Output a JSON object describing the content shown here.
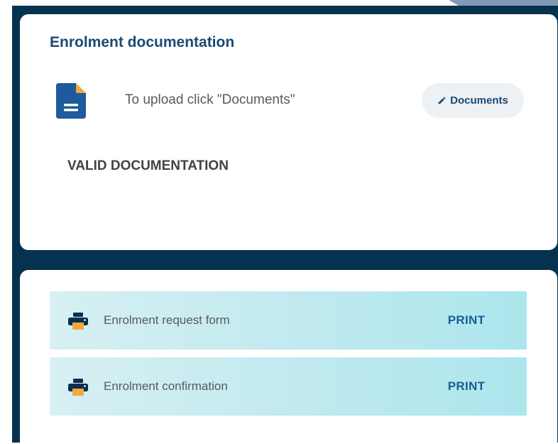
{
  "enrolment_documentation": {
    "title": "Enrolment documentation",
    "icon": "document-icon",
    "upload_hint": "To upload click \"Documents\"",
    "documents_button": {
      "label": "Documents",
      "icon": "pencil-icon"
    },
    "valid_heading": "VALID DOCUMENTATION"
  },
  "print_list": {
    "items": [
      {
        "label": "Enrolment request form",
        "icon": "printer-icon",
        "action_label": "PRINT"
      },
      {
        "label": "Enrolment confirmation",
        "icon": "printer-icon",
        "action_label": "PRINT"
      }
    ]
  },
  "colors": {
    "frame": "#05324f",
    "accent": "#1a4a72",
    "doc_icon_blue": "#1e5a9c",
    "doc_icon_fold": "#f2a93b",
    "printer_body": "#0b2f4f",
    "printer_paper": "#f2a93b",
    "row_gradient_start": "#d7f0f3",
    "row_gradient_end": "#ade6ee"
  }
}
